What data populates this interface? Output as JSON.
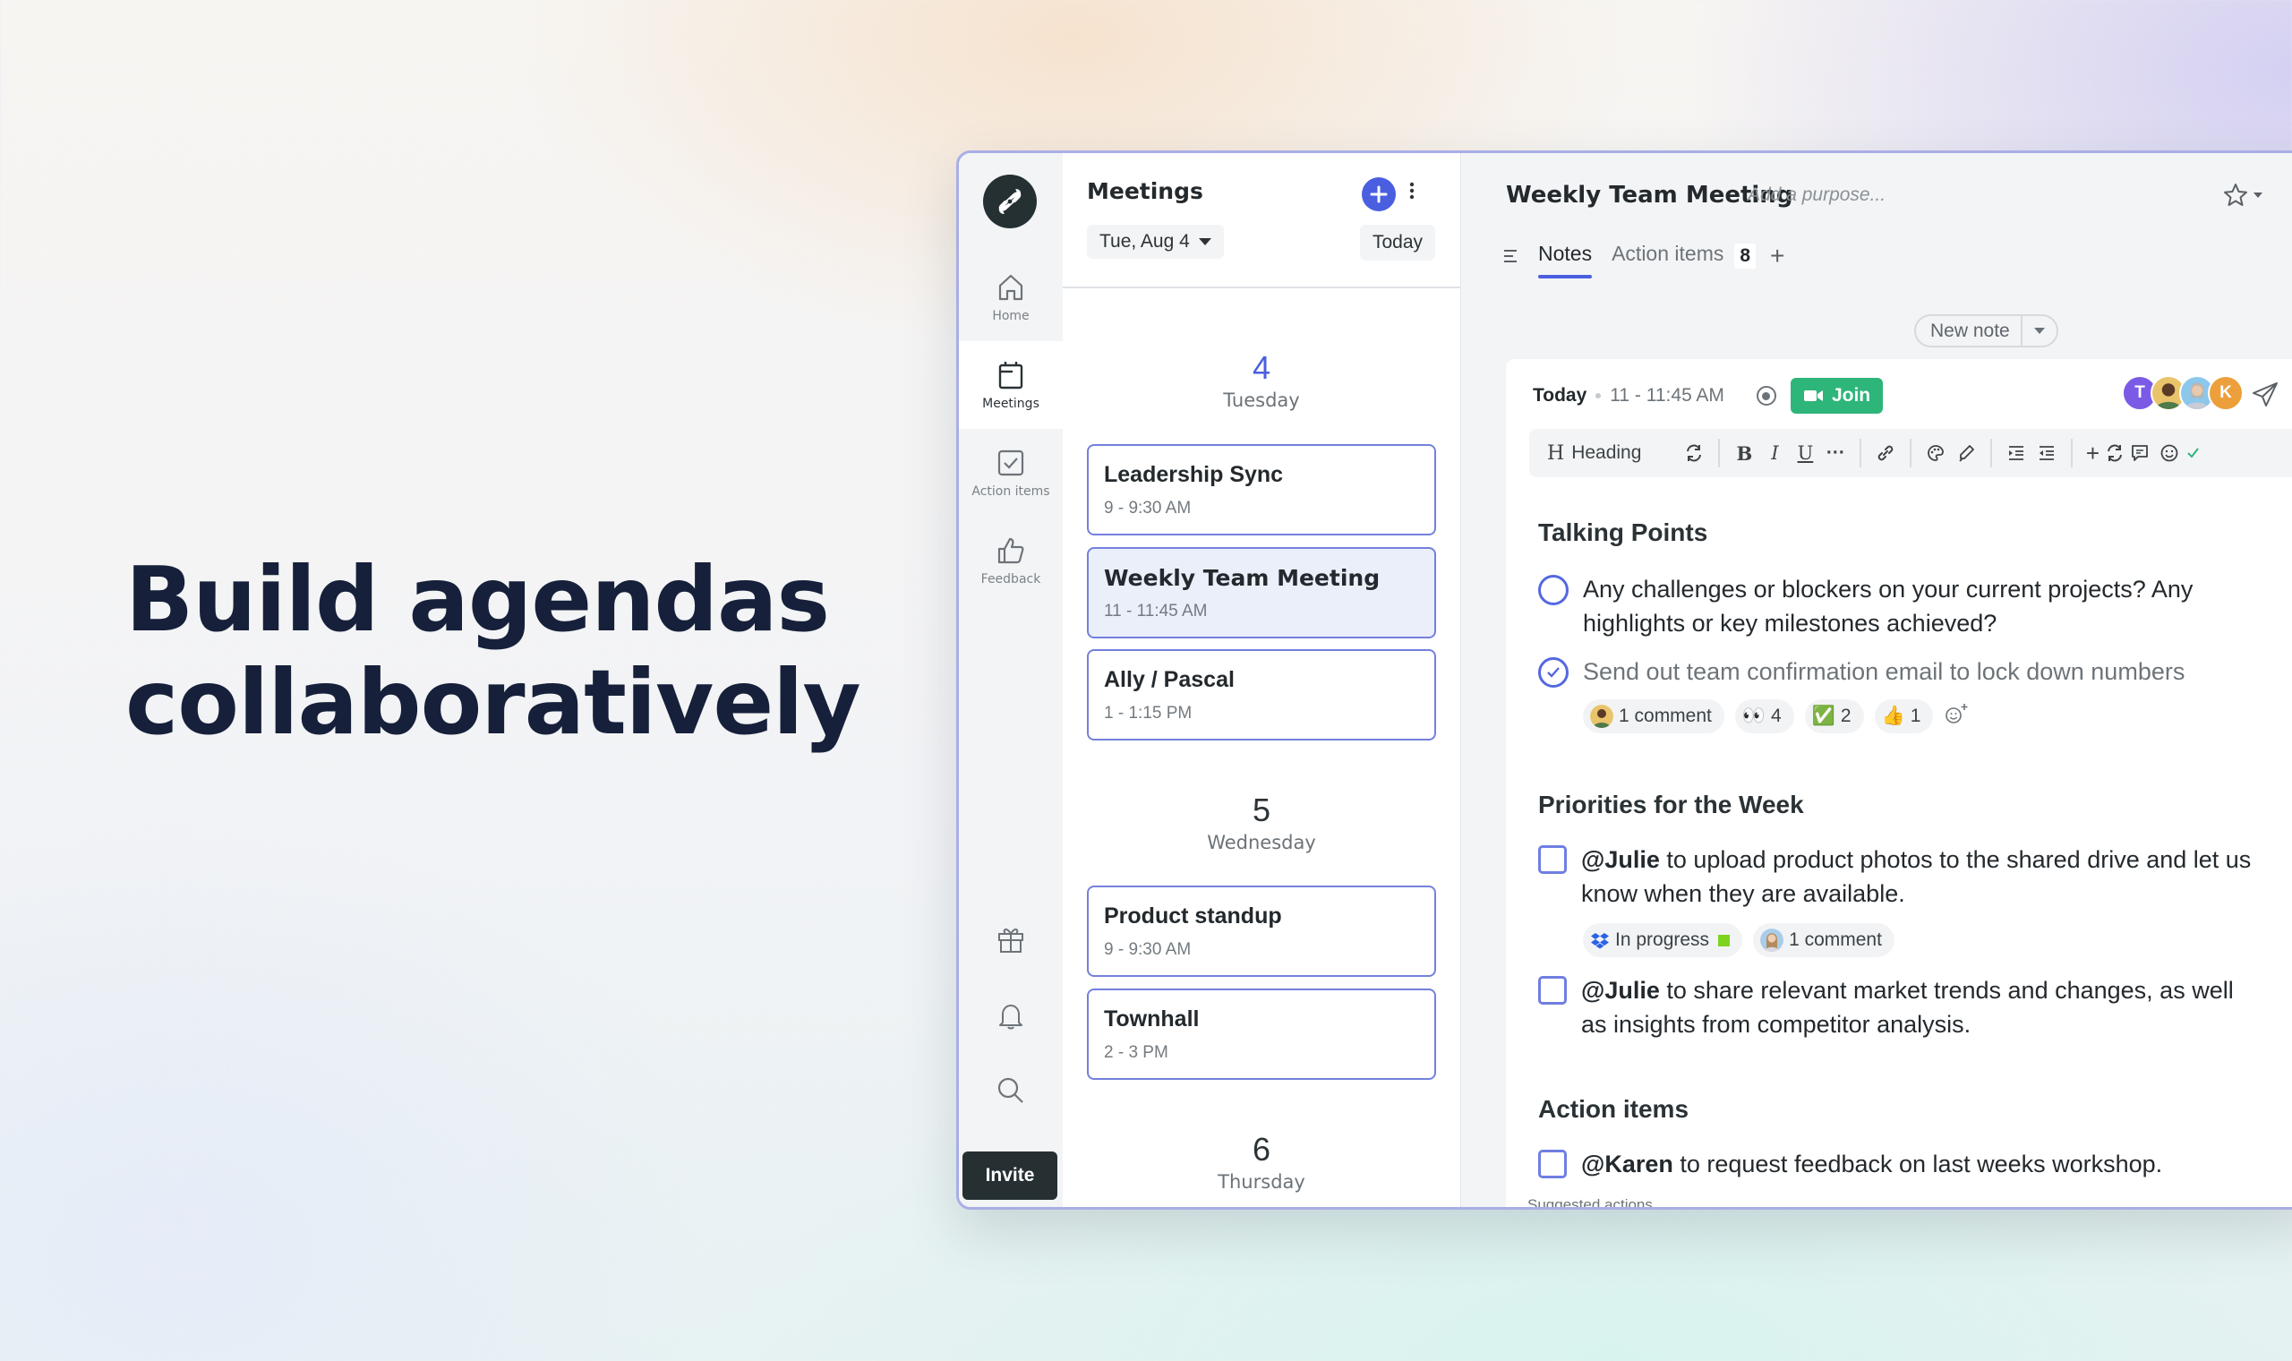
{
  "hero": {
    "line1": "Build agendas",
    "line2": "collaboratively"
  },
  "colors": {
    "accent": "#4a5fe0",
    "join_green": "#2eb57a",
    "invite_dark": "#263033",
    "heading_navy": "#16203a"
  },
  "rail": {
    "items": [
      {
        "label": "Home",
        "icon": "home-icon",
        "active": false
      },
      {
        "label": "Meetings",
        "icon": "calendar-icon",
        "active": true
      },
      {
        "label": "Action items",
        "icon": "checkbox-icon",
        "active": false
      },
      {
        "label": "Feedback",
        "icon": "thumbs-up-icon",
        "active": false
      }
    ],
    "bottom_icons": [
      "gift-icon",
      "bell-icon",
      "search-icon"
    ],
    "invite_label": "Invite"
  },
  "meetings": {
    "title": "Meetings",
    "date_picker": "Tue, Aug 4",
    "today_label": "Today",
    "days": [
      {
        "num": "4",
        "name": "Tuesday",
        "is_today": true,
        "meetings": [
          {
            "title": "Leadership Sync",
            "time": "9 - 9:30 AM",
            "selected": false
          },
          {
            "title": "Weekly Team Meeting",
            "time": "11 - 11:45 AM",
            "selected": true
          },
          {
            "title": "Ally / Pascal",
            "time": "1 - 1:15 PM",
            "selected": false
          }
        ]
      },
      {
        "num": "5",
        "name": "Wednesday",
        "is_today": false,
        "meetings": [
          {
            "title": "Product standup",
            "time": "9 - 9:30 AM",
            "selected": false
          },
          {
            "title": "Townhall",
            "time": "2 - 3 PM",
            "selected": false
          }
        ]
      },
      {
        "num": "6",
        "name": "Thursday",
        "is_today": false,
        "meetings": []
      }
    ]
  },
  "main": {
    "title": "Weekly Team Meeting",
    "purpose_placeholder": "Add a purpose...",
    "tabs": [
      {
        "label": "Notes",
        "active": true
      },
      {
        "label": "Action items",
        "active": false,
        "count": "8"
      }
    ],
    "add_tab": "+",
    "new_note_label": "New note",
    "note": {
      "day": "Today",
      "time": "11 - 11:45 AM",
      "join_label": "Join",
      "attendees": [
        {
          "initial": "T",
          "color": "#7b5ae6"
        },
        {
          "initial": "",
          "color": "#e9c46a"
        },
        {
          "initial": "",
          "color": "#8cc7ec"
        },
        {
          "initial": "K",
          "color": "#ec9f3b"
        }
      ],
      "toolbar": {
        "heading_label": "Heading",
        "heading_glyph": "H",
        "bold": "B",
        "italic": "I",
        "underline": "U",
        "more": "···",
        "plus": "+"
      },
      "sections": [
        {
          "title": "Talking Points",
          "items": [
            {
              "type": "talking-point",
              "checked": false,
              "text": "Any challenges or blockers on your current projects? Any highlights or key milestones achieved?"
            },
            {
              "type": "talking-point",
              "checked": true,
              "text": "Send out team confirmation email to lock down numbers",
              "chips": {
                "comments": "1 comment",
                "reactions": [
                  {
                    "emoji": "👀",
                    "count": "4"
                  },
                  {
                    "emoji": "✅",
                    "count": "2"
                  },
                  {
                    "emoji": "👍",
                    "count": "1"
                  }
                ]
              }
            }
          ]
        },
        {
          "title": "Priorities for the Week",
          "items": [
            {
              "type": "action",
              "mention": "@Julie",
              "text": " to upload product photos to the shared drive and let us know when they are available.",
              "chips": {
                "status": "In progress",
                "comments": "1 comment"
              }
            },
            {
              "type": "action",
              "mention": "@Julie",
              "text": " to share relevant market trends and changes, as well as insights from competitor analysis."
            }
          ]
        },
        {
          "title": "Action items",
          "items": [
            {
              "type": "action",
              "mention": "@Karen",
              "text": " to request feedback on last weeks workshop."
            }
          ]
        }
      ],
      "suggested_label": "Suggested actions"
    }
  }
}
